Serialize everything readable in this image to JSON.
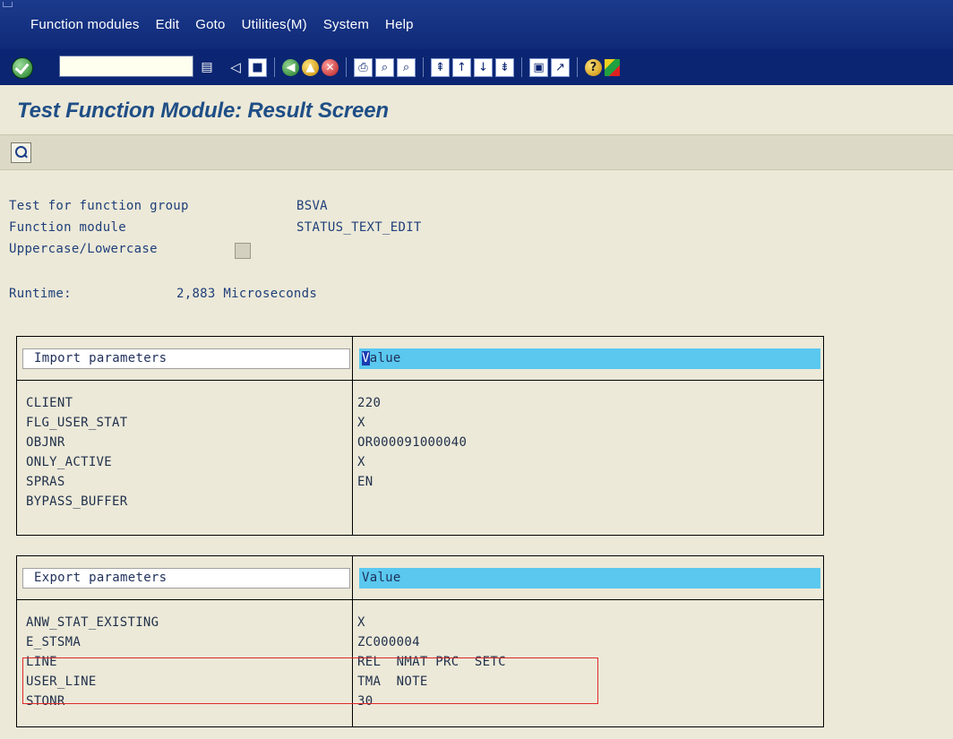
{
  "menubar": {
    "items": [
      "Function modules",
      "Edit",
      "Goto",
      "Utilities(M)",
      "System",
      "Help"
    ]
  },
  "toolbar": {
    "command_field_value": "",
    "icons": [
      "enter-icon",
      "command-field",
      "back-icon",
      "save-icon",
      "back-green-icon",
      "exit-icon",
      "cancel-icon",
      "print-icon",
      "find-icon",
      "find-next-icon",
      "first-page-icon",
      "previous-page-icon",
      "next-page-icon",
      "last-page-icon",
      "create-session-icon",
      "shortcut-icon",
      "help-icon",
      "layout-icon"
    ]
  },
  "title": "Test Function Module: Result Screen",
  "app_toolbar": {
    "icons": [
      "detail-view-icon"
    ]
  },
  "info": {
    "function_group_label": "Test for function group",
    "function_group_value": "BSVA",
    "function_module_label": "Function module",
    "function_module_value": "STATUS_TEXT_EDIT",
    "case_label": "Uppercase/Lowercase",
    "case_checked": false,
    "runtime_label": "Runtime:",
    "runtime_value": "2,883 Microseconds"
  },
  "import_table": {
    "header_param": "Import parameters",
    "header_value_first": "V",
    "header_value_rest": "alue",
    "rows": [
      {
        "name": "CLIENT",
        "value": "220"
      },
      {
        "name": "FLG_USER_STAT",
        "value": "X"
      },
      {
        "name": "OBJNR",
        "value": "OR000091000040"
      },
      {
        "name": "ONLY_ACTIVE",
        "value": "X"
      },
      {
        "name": "SPRAS",
        "value": "EN"
      },
      {
        "name": "BYPASS_BUFFER",
        "value": ""
      }
    ]
  },
  "export_table": {
    "header_param": "Export parameters",
    "header_value": "Value",
    "rows": [
      {
        "name": "ANW_STAT_EXISTING",
        "value": "X"
      },
      {
        "name": "E_STSMA",
        "value": "ZC000004"
      },
      {
        "name": "LINE",
        "value": "REL  NMAT PRC  SETC"
      },
      {
        "name": "USER_LINE",
        "value": "TMA  NOTE"
      },
      {
        "name": "STONR",
        "value": "30"
      }
    ]
  },
  "colors": {
    "menubar": "#0f2a78",
    "title": "#1f4e86",
    "header_value_bg": "#5ac8ef",
    "highlight_box": "#e02828"
  }
}
